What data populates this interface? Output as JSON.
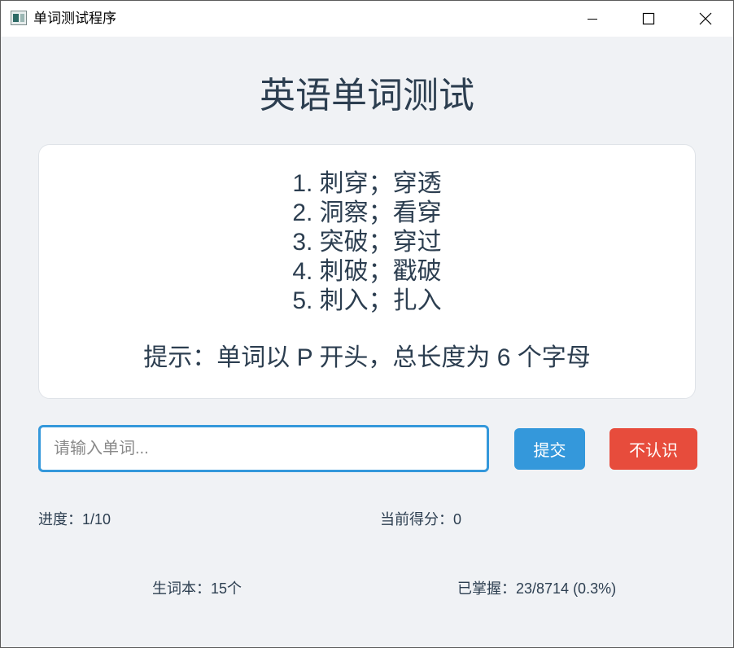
{
  "window": {
    "title": "单词测试程序",
    "icon": "app-icon",
    "controls": [
      "minimize-icon",
      "maximize-icon",
      "close-icon"
    ]
  },
  "heading": "英语单词测试",
  "meanings": [
    "1. 刺穿；穿透",
    "2. 洞察；看穿",
    "3. 突破；穿过",
    "4. 刺破；戳破",
    "5. 刺入；扎入"
  ],
  "hint": "提示：单词以 P 开头，总长度为 6 个字母",
  "input": {
    "placeholder": "请输入单词...",
    "value": ""
  },
  "buttons": {
    "submit": "提交",
    "unknown": "不认识"
  },
  "stats": {
    "progress": "进度：1/10",
    "score": "当前得分：0",
    "vocab_book": "生词本：15个",
    "mastered": "已掌握：23/8714 (0.3%)"
  },
  "colors": {
    "primary": "#3498db",
    "danger": "#e74c3c",
    "text": "#2c3e50",
    "background": "#f0f2f5"
  }
}
